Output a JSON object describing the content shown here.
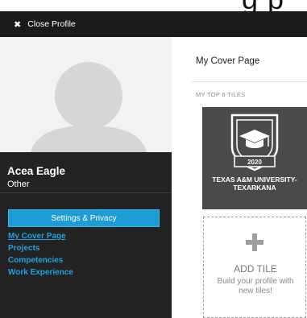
{
  "top_fragment": "g p",
  "header": {
    "close_icon": "close-x-icon",
    "close_label": "Close Profile"
  },
  "profile": {
    "avatar_icon": "default-avatar-icon",
    "name": "Acea Eagle",
    "role": "Other",
    "settings_label": "Settings & Privacy"
  },
  "nav": {
    "items": [
      {
        "label": "My Cover Page",
        "active": true
      },
      {
        "label": "Projects",
        "active": false
      },
      {
        "label": "Competencies",
        "active": false
      },
      {
        "label": "Work Experience",
        "active": false
      }
    ]
  },
  "main": {
    "title": "My Cover Page",
    "section_label": "MY TOP 8 TILES",
    "tiles": [
      {
        "icon": "graduation-cap-shield-icon",
        "year": "2020",
        "caption_line1": "TEXAS A&M UNIVERSITY-",
        "caption_line2": "TEXARKANA"
      }
    ],
    "add_tile": {
      "icon": "plus-icon",
      "title": "ADD TILE",
      "description_line1": "Build your profile with",
      "description_line2": "new tiles!"
    }
  },
  "colors": {
    "header_bg": "#1b1b1b",
    "sidebar_bg": "#232323",
    "accent_blue": "#1f9bd6",
    "link_blue": "#1fa1e0",
    "tile_bg": "#4a4a4a"
  }
}
